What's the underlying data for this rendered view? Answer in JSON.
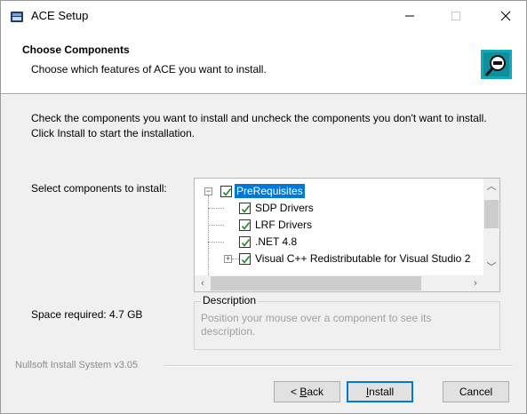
{
  "window": {
    "title": "ACE Setup",
    "icon": "installer-app-icon",
    "controls": {
      "minimize": "minimize-icon",
      "maximize": "maximize-icon",
      "close": "close-icon"
    }
  },
  "header": {
    "title": "Choose Components",
    "subtitle": "Choose which features of ACE you want to install.",
    "logo": "installer-logo-icon"
  },
  "instruction": "Check the components you want to install and uncheck the components you don't want to install. Click Install to start the installation.",
  "select_label": "Select components to install:",
  "space_required": "Space required: 4.7 GB",
  "components": [
    {
      "label": "PreRequisites",
      "checked": true,
      "selected": true,
      "expanded": true,
      "level": 0
    },
    {
      "label": "SDP Drivers",
      "checked": true,
      "level": 1
    },
    {
      "label": "LRF Drivers",
      "checked": true,
      "level": 1
    },
    {
      "label": ".NET 4.8",
      "checked": true,
      "level": 1
    },
    {
      "label": "Visual C++ Redistributable for Visual Studio 2",
      "checked": true,
      "level": 1,
      "expandable": true
    }
  ],
  "description": {
    "title": "Description",
    "text": "Position your mouse over a component to see its description."
  },
  "branding": "Nullsoft Install System v3.05",
  "buttons": {
    "back": {
      "prefix": "< ",
      "mnemonic": "B",
      "rest": "ack"
    },
    "install": {
      "mnemonic": "I",
      "rest": "nstall"
    },
    "cancel": "Cancel"
  },
  "colors": {
    "selection": "#0078d7",
    "check": "#1a8a1a"
  }
}
